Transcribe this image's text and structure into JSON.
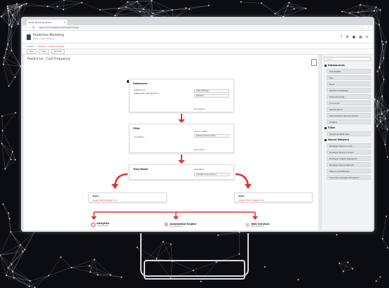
{
  "browser": {
    "tab_title": "Node Modeling Studio",
    "url": "app.cloud-analytics.example/modeler"
  },
  "app": {
    "title": "Predictive Modeling",
    "subtitle": "Node Graph Modeler",
    "project_name": "Predict Inc. Cust Frequency"
  },
  "breadcrumbs": [
    "Project",
    "Predict — Model 1 Graph"
  ],
  "toolbar": [
    "Run",
    "Save",
    "Redraw"
  ],
  "canvas": {
    "nodes": {
      "datasource": {
        "title": "Datasource",
        "dataset_label": "Datasource",
        "dataset_value": "CRM/SALES, PRODUCTS v",
        "param1": "Date Settings",
        "param2": "Partition",
        "footer": "Run Cache"
      },
      "filter": {
        "title": "Filter",
        "label": "Conditions",
        "value": "Between Fiscal Dates",
        "field": "Column Filter",
        "footer": "Run Cache"
      },
      "train_model": {
        "title": "Train Model",
        "label": "Algorithm",
        "value": "Classifier tree (Auto) v"
      },
      "apply_left": {
        "title": "Apply",
        "label": "Apply Tree Classifier 4.0"
      },
      "apply_right": {
        "title": "Apply",
        "label": "Predict Train Classifier 4.0"
      }
    },
    "outputs": [
      {
        "name": "Analytics",
        "sub": "Cloud Engine",
        "color": "#d33"
      },
      {
        "name": "Automation Engine",
        "sub": "Live Workflow",
        "color": "#d33"
      },
      {
        "name": "Web Services",
        "sub": "REST Endpoint",
        "color": "#d33"
      }
    ]
  },
  "sidebar": {
    "search_placeholder": "Search",
    "sections": [
      {
        "title": "Datasources",
        "items": [
          "Flat Datafile",
          "SQL",
          "Excel",
          "Relational Database",
          "Extracted Fields",
          "Form Input",
          "Rest Endpoint",
          "Administration Security Model",
          "Graphql"
        ]
      },
      {
        "title": "Filter",
        "items": [
          "Relational Table Filter"
        ]
      },
      {
        "title": "Neural Network",
        "items": [
          "Multilayer Neurons Auto",
          "Multilayer Neurons Graph",
          "Multilayer Logistic Regression",
          "Multilayer Neural Network",
          "Base vs All Multiclass",
          "Tree Class Averaged Perceptron"
        ]
      }
    ]
  },
  "colors": {
    "accent": "#d33",
    "background": "#0b0d10",
    "frame": "#d9dde2"
  }
}
